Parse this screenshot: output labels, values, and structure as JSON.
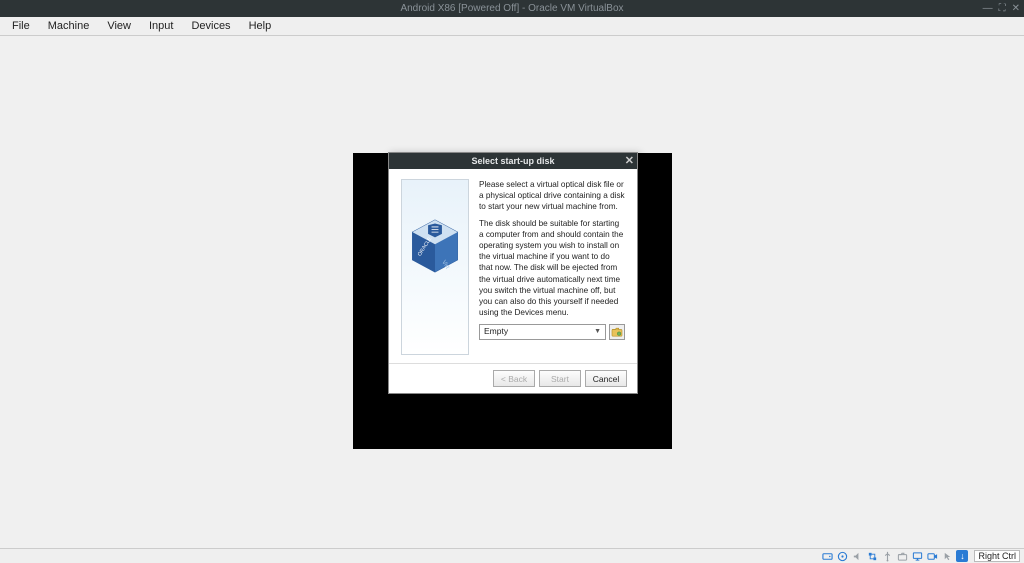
{
  "window": {
    "title": "Android X86 [Powered Off] - Oracle VM VirtualBox"
  },
  "menu": {
    "items": [
      "File",
      "Machine",
      "View",
      "Input",
      "Devices",
      "Help"
    ]
  },
  "dialog": {
    "title": "Select start-up disk",
    "para1": "Please select a virtual optical disk file or a physical optical drive containing a disk to start your new virtual machine from.",
    "para2": "The disk should be suitable for starting a computer from and should contain the operating system you wish to install on the virtual machine if you want to do that now. The disk will be ejected from the virtual drive automatically next time you switch the virtual machine off, but you can also do this yourself if needed using the Devices menu.",
    "disk_selected": "Empty",
    "buttons": {
      "back": "< Back",
      "start": "Start",
      "cancel": "Cancel"
    }
  },
  "statusbar": {
    "capture_key": "Right Ctrl"
  }
}
